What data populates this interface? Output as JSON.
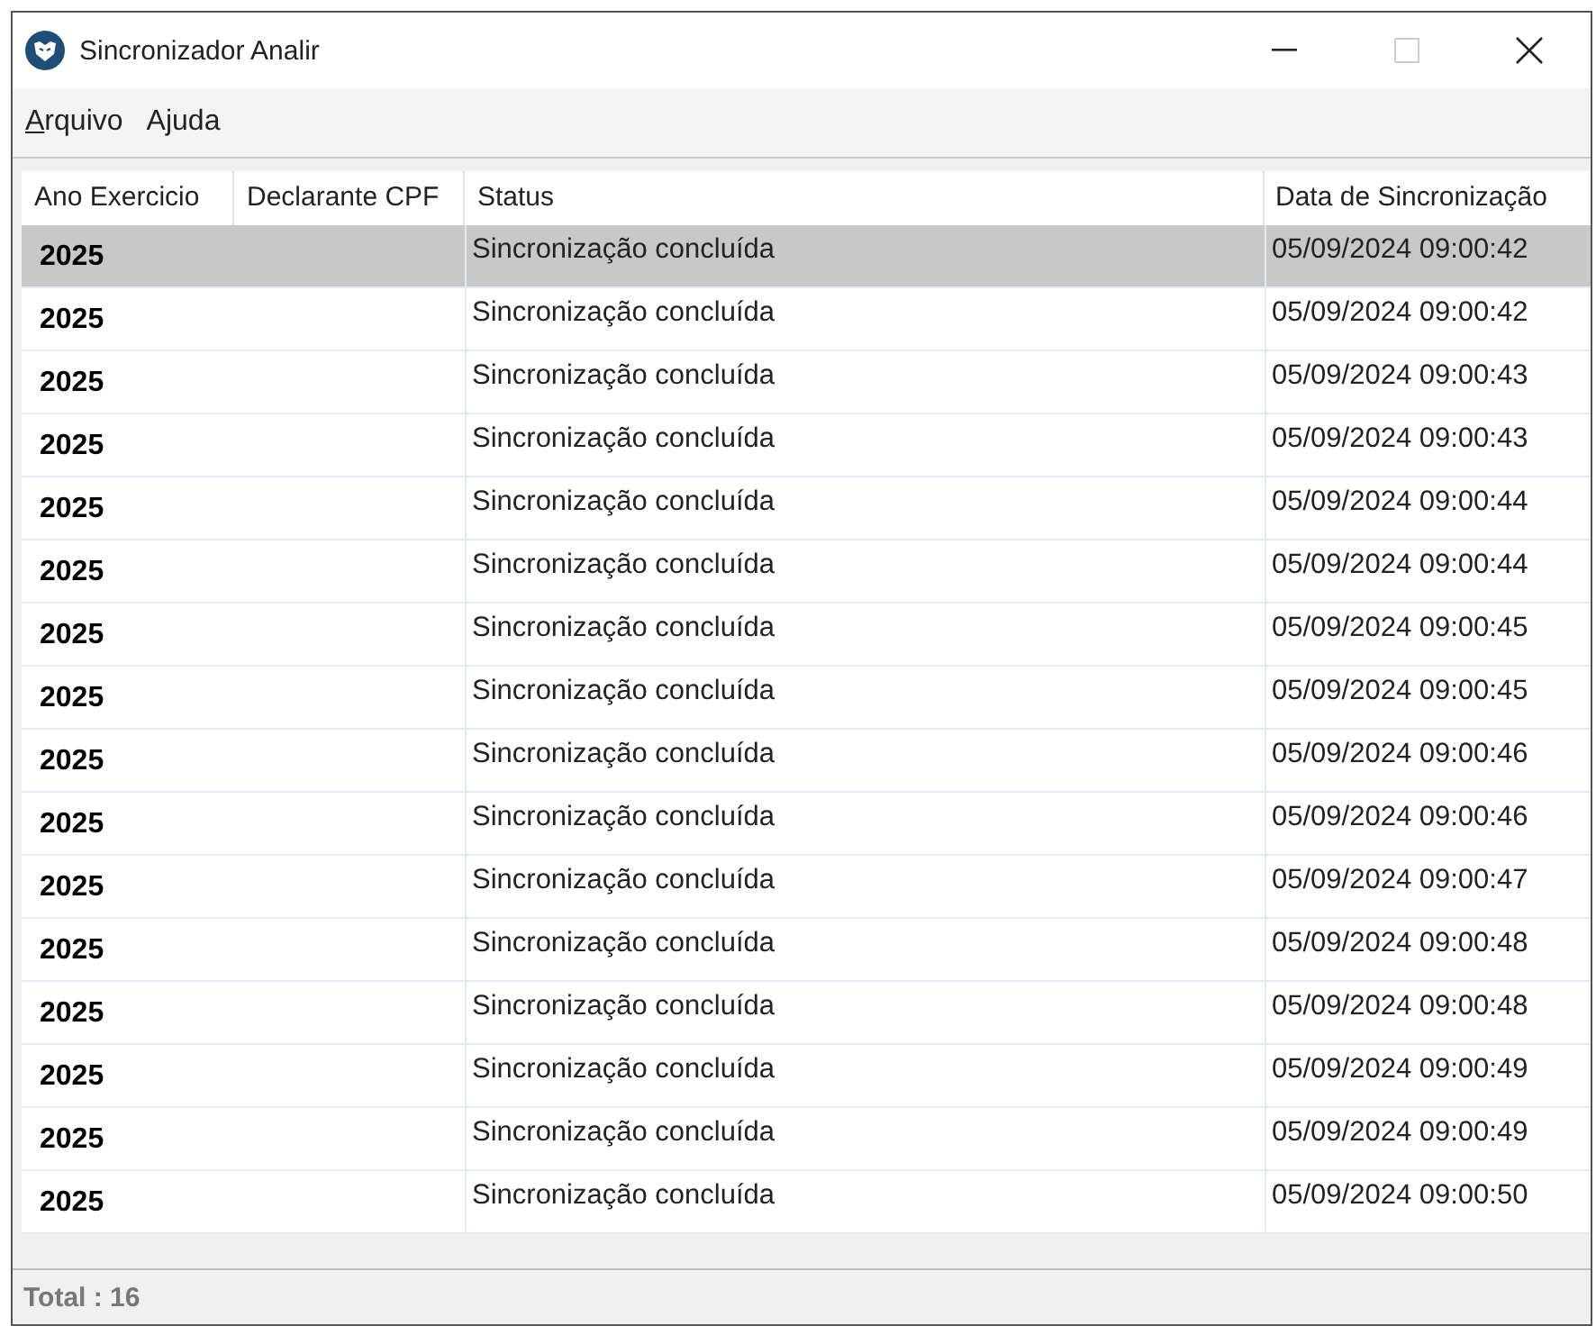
{
  "window": {
    "title": "Sincronizador Analir"
  },
  "menu": [
    {
      "label": "Arquivo",
      "mnemonic_underlined": true
    },
    {
      "label": "Ajuda",
      "mnemonic_underlined": false
    }
  ],
  "table": {
    "columns": [
      "Ano Exercicio",
      "Declarante CPF",
      "Status",
      "Data de Sincronização"
    ],
    "rows": [
      {
        "ano": "2025",
        "status": "Sincronização concluída",
        "data": "05/09/2024 09:00:42",
        "selected": true
      },
      {
        "ano": "2025",
        "status": "Sincronização concluída",
        "data": "05/09/2024 09:00:42",
        "selected": false
      },
      {
        "ano": "2025",
        "status": "Sincronização concluída",
        "data": "05/09/2024 09:00:43",
        "selected": false
      },
      {
        "ano": "2025",
        "status": "Sincronização concluída",
        "data": "05/09/2024 09:00:43",
        "selected": false
      },
      {
        "ano": "2025",
        "status": "Sincronização concluída",
        "data": "05/09/2024 09:00:44",
        "selected": false
      },
      {
        "ano": "2025",
        "status": "Sincronização concluída",
        "data": "05/09/2024 09:00:44",
        "selected": false
      },
      {
        "ano": "2025",
        "status": "Sincronização concluída",
        "data": "05/09/2024 09:00:45",
        "selected": false
      },
      {
        "ano": "2025",
        "status": "Sincronização concluída",
        "data": "05/09/2024 09:00:45",
        "selected": false
      },
      {
        "ano": "2025",
        "status": "Sincronização concluída",
        "data": "05/09/2024 09:00:46",
        "selected": false
      },
      {
        "ano": "2025",
        "status": "Sincronização concluída",
        "data": "05/09/2024 09:00:46",
        "selected": false
      },
      {
        "ano": "2025",
        "status": "Sincronização concluída",
        "data": "05/09/2024 09:00:47",
        "selected": false
      },
      {
        "ano": "2025",
        "status": "Sincronização concluída",
        "data": "05/09/2024 09:00:48",
        "selected": false
      },
      {
        "ano": "2025",
        "status": "Sincronização concluída",
        "data": "05/09/2024 09:00:48",
        "selected": false
      },
      {
        "ano": "2025",
        "status": "Sincronização concluída",
        "data": "05/09/2024 09:00:49",
        "selected": false
      },
      {
        "ano": "2025",
        "status": "Sincronização concluída",
        "data": "05/09/2024 09:00:49",
        "selected": false
      },
      {
        "ano": "2025",
        "status": "Sincronização concluída",
        "data": "05/09/2024 09:00:50",
        "selected": false
      }
    ]
  },
  "status_bar": {
    "total": "Total : 16"
  }
}
